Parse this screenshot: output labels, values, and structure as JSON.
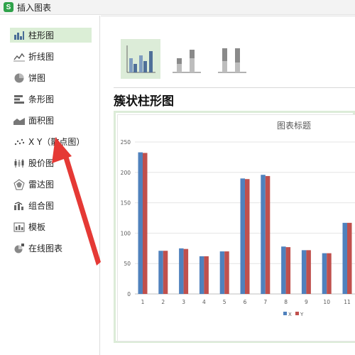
{
  "window": {
    "app_icon": "S",
    "title": "插入图表"
  },
  "sidebar": {
    "items": [
      {
        "label": "柱形图",
        "icon": "column-chart-icon",
        "selected": true
      },
      {
        "label": "折线图",
        "icon": "line-chart-icon",
        "selected": false
      },
      {
        "label": "饼图",
        "icon": "pie-chart-icon",
        "selected": false
      },
      {
        "label": "条形图",
        "icon": "bar-chart-icon",
        "selected": false
      },
      {
        "label": "面积图",
        "icon": "area-chart-icon",
        "selected": false
      },
      {
        "label": "X Y（散点图）",
        "icon": "scatter-chart-icon",
        "selected": false
      },
      {
        "label": "股价图",
        "icon": "stock-chart-icon",
        "selected": false
      },
      {
        "label": "雷达图",
        "icon": "radar-chart-icon",
        "selected": false
      },
      {
        "label": "组合图",
        "icon": "combo-chart-icon",
        "selected": false
      },
      {
        "label": "模板",
        "icon": "template-icon",
        "selected": false
      },
      {
        "label": "在线图表",
        "icon": "online-chart-icon",
        "selected": false
      }
    ]
  },
  "main": {
    "subtypes": [
      {
        "icon": "clustered-column-icon",
        "selected": true
      },
      {
        "icon": "stacked-column-icon",
        "selected": false
      },
      {
        "icon": "percent-stacked-column-icon",
        "selected": false
      }
    ],
    "section_title": "簇状柱形图"
  },
  "colors": {
    "series_x": "#4f81bd",
    "series_y": "#c0504d",
    "selected_bg": "#dbeed6",
    "arrow": "#e53935"
  },
  "chart_data": {
    "type": "bar",
    "title": "图表标题",
    "categories": [
      "1",
      "2",
      "3",
      "4",
      "5",
      "6",
      "7",
      "8",
      "9",
      "10",
      "11"
    ],
    "series": [
      {
        "name": "X",
        "values": [
          233,
          71,
          75,
          62,
          70,
          190,
          196,
          78,
          72,
          67,
          117
        ]
      },
      {
        "name": "Y",
        "values": [
          232,
          71,
          74,
          62,
          70,
          189,
          194,
          77,
          72,
          67,
          117
        ]
      }
    ],
    "yticks": [
      "0",
      "50",
      "100",
      "150",
      "200",
      "250"
    ],
    "ylim": [
      0,
      250
    ],
    "grid": true,
    "legend": "bottom"
  }
}
